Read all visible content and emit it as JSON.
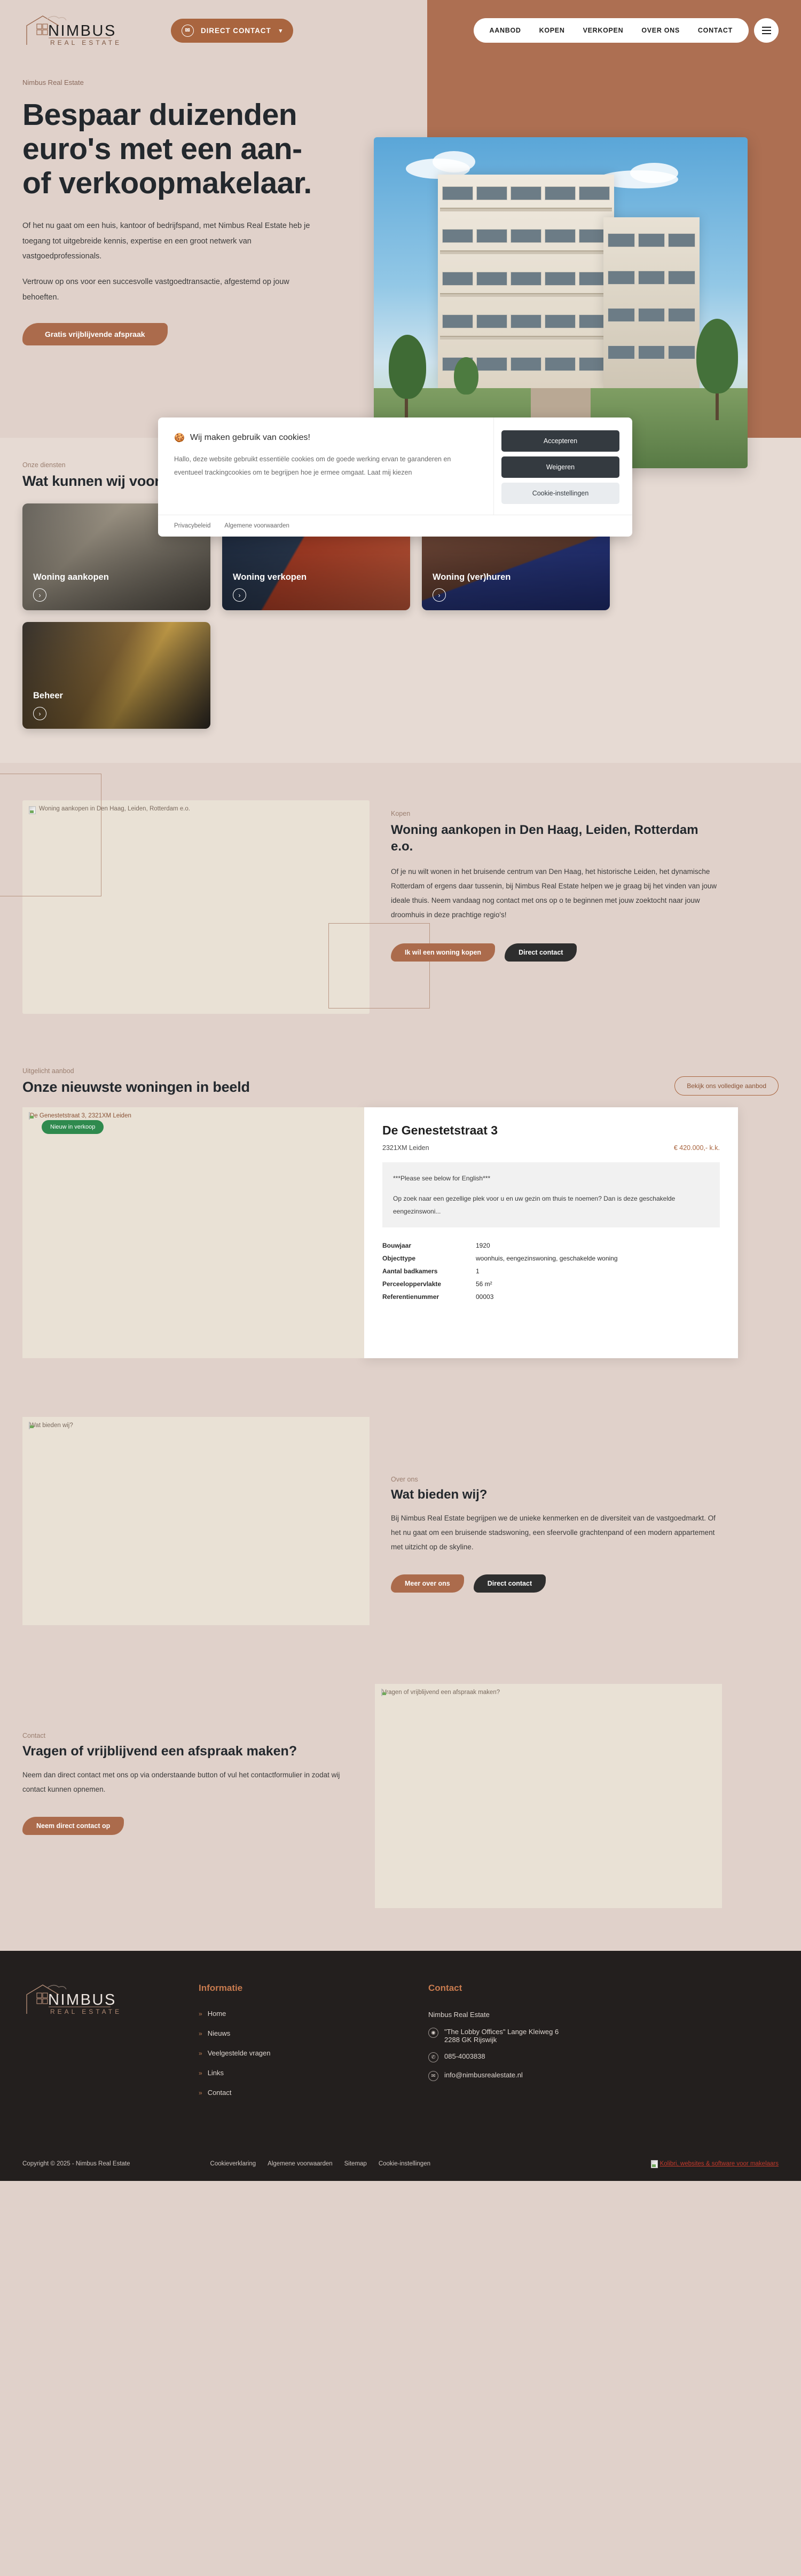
{
  "brand": {
    "name_top": "NIMBUS",
    "name_bottom": "REAL ESTATE"
  },
  "header": {
    "direct_contact_label": "DIRECT CONTACT",
    "mail_icon": "mail-icon",
    "chevron_icon": "chevron-down-icon",
    "nav": [
      {
        "label": "AANBOD"
      },
      {
        "label": "KOPEN"
      },
      {
        "label": "VERKOPEN"
      },
      {
        "label": "OVER ONS"
      },
      {
        "label": "CONTACT"
      }
    ],
    "menu_icon": "hamburger-menu-icon"
  },
  "hero": {
    "eyebrow": "Nimbus Real Estate",
    "title": "Bespaar duizenden euro's met een aan- of verkoopmakelaar.",
    "paragraph1": "Of het nu gaat om een huis, kantoor of bedrijfspand, met Nimbus Real Estate heb je toegang tot uitgebreide kennis, expertise en een groot netwerk van vastgoedprofessionals.",
    "paragraph2": "Vertrouw op ons voor een succesvolle vastgoedtransactie, afgestemd op jouw behoeften.",
    "cta_label": "Gratis vrijblijvende afspraak"
  },
  "cookie": {
    "icon": "cookie-icon",
    "title": "Wij maken gebruik van cookies!",
    "body": "Hallo, deze website gebruikt essentiële cookies om de goede werking ervan te garanderen en eventueel trackingcookies om te begrijpen hoe je ermee omgaat. Laat mij kiezen",
    "accept_label": "Accepteren",
    "deny_label": "Weigeren",
    "settings_label": "Cookie-instellingen",
    "link_privacy": "Privacybeleid",
    "link_terms": "Algemene voorwaarden"
  },
  "services": {
    "eyebrow": "Onze diensten",
    "title": "Wat kunnen wij voor jou betekenen?",
    "cards": [
      {
        "label": "Woning aankopen",
        "arrow_icon": "chevron-right-circle-icon"
      },
      {
        "label": "Woning verkopen",
        "arrow_icon": "chevron-right-circle-icon"
      },
      {
        "label": "Woning (ver)huren",
        "arrow_icon": "chevron-right-circle-icon"
      },
      {
        "label": "Beheer",
        "arrow_icon": "chevron-right-circle-icon"
      }
    ]
  },
  "kopen": {
    "image_alt": "Woning aankopen in Den Haag, Leiden, Rotterdam e.o.",
    "eyebrow": "Kopen",
    "title": "Woning aankopen in Den Haag, Leiden, Rotterdam e.o.",
    "paragraph": "Of je nu wilt wonen in het bruisende centrum van Den Haag, het historische Leiden, het dynamische Rotterdam of ergens daar tussenin, bij Nimbus Real Estate helpen we je graag bij het vinden van jouw ideale thuis. Neem vandaag nog contact met ons op o te beginnen met jouw zoektocht naar jouw droomhuis in deze prachtige regio's!",
    "cta_primary": "Ik wil een woning kopen",
    "cta_secondary": "Direct contact"
  },
  "aanbod": {
    "eyebrow": "Uitgelicht aanbod",
    "title": "Onze nieuwste woningen in beeld",
    "view_all_label": "Bekijk ons volledige aanbod",
    "listing": {
      "badge": "Nieuw in verkoop",
      "image_alt": "De Genestetstraat 3, 2321XM Leiden",
      "title": "De Genestetstraat 3",
      "address": "2321XM Leiden",
      "price": "€ 420.000,- k.k.",
      "desc_line1": "***Please see below for English***",
      "desc_line2": "Op zoek naar een gezellige plek voor u en uw gezin om thuis te noemen? Dan is deze geschakelde eengezinswoni...",
      "specs": [
        {
          "key": "Bouwjaar",
          "value": "1920"
        },
        {
          "key": "Objecttype",
          "value": "woonhuis, eengezinswoning, geschakelde woning"
        },
        {
          "key": "Aantal badkamers",
          "value": "1"
        },
        {
          "key": "Perceeloppervlakte",
          "value": "56 m²"
        },
        {
          "key": "Referentienummer",
          "value": "00003"
        }
      ]
    }
  },
  "overons": {
    "image_alt": "Wat bieden wij?",
    "eyebrow": "Over ons",
    "title": "Wat bieden wij?",
    "paragraph": "Bij Nimbus Real Estate begrijpen we de unieke kenmerken en de diversiteit van de vastgoedmarkt. Of het nu gaat om een bruisende stadswoning, een sfeervolle grachtenpand of een modern appartement met uitzicht op de skyline.",
    "cta_primary": "Meer over ons",
    "cta_secondary": "Direct contact"
  },
  "contact_section": {
    "eyebrow": "Contact",
    "title": "Vragen of vrijblijvend een afspraak maken?",
    "paragraph": "Neem dan direct contact met ons op via onderstaande button of vul het contactformulier in zodat wij contact kunnen opnemen.",
    "cta_label": "Neem direct contact op",
    "image_alt": "Vragen of vrijblijvend een afspraak maken?"
  },
  "footer": {
    "info_heading": "Informatie",
    "info_links": [
      {
        "label": "Home"
      },
      {
        "label": "Nieuws"
      },
      {
        "label": "Veelgestelde vragen"
      },
      {
        "label": "Links"
      },
      {
        "label": "Contact"
      }
    ],
    "contact_heading": "Contact",
    "company": "Nimbus Real Estate",
    "address_line1": "\"The Lobby Offices\" Lange Kleiweg 6",
    "address_line2": "2288 GK Rijswijk",
    "phone": "085-4003838",
    "email": "info@nimbusrealestate.nl",
    "location_icon": "location-pin-icon",
    "phone_icon": "phone-icon",
    "mail_icon": "mail-icon",
    "copyright": "Copyright © 2025 - Nimbus Real Estate",
    "bottom_links": [
      {
        "label": "Cookieverklaring"
      },
      {
        "label": "Algemene voorwaarden"
      },
      {
        "label": "Sitemap"
      },
      {
        "label": "Cookie-instellingen"
      }
    ],
    "credit": "Kolibri, websites & software voor makelaars"
  },
  "colors": {
    "bg": "#e0d1ca",
    "accent": "#a9653f",
    "dark": "#231f1e",
    "badge_green": "#2f8a4e"
  }
}
